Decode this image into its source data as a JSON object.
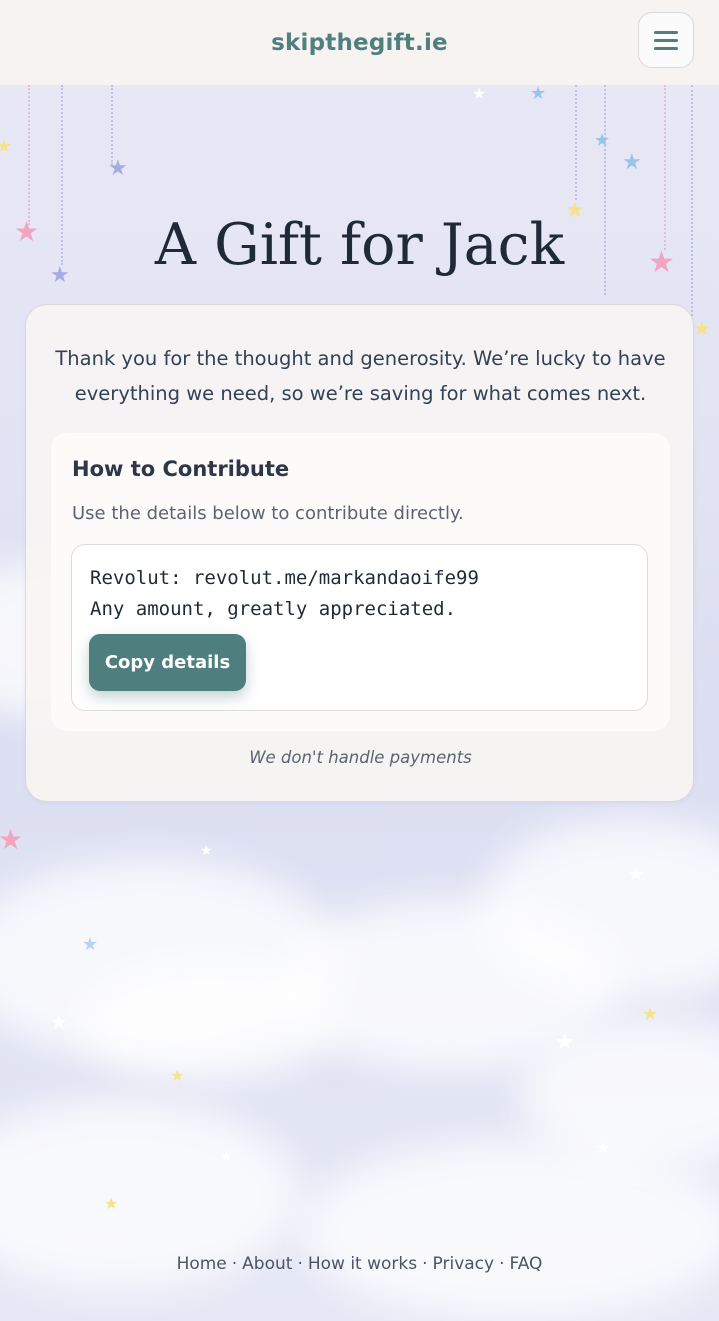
{
  "header": {
    "brand": "skipthegift.ie",
    "menu_icon": "hamburger-menu-icon"
  },
  "page": {
    "title": "A Gift for Jack",
    "intro": "Thank you for the thought and generosity. We’re lucky to have everything we need, so we’re saving for what comes next."
  },
  "contribute": {
    "heading": "How to Contribute",
    "description": "Use the details below to contribute directly.",
    "details_line1": "Revolut: revolut.me/markandaoife99",
    "details_line2": "Any amount, greatly appreciated.",
    "copy_label": "Copy details"
  },
  "disclaimer": "We don't handle payments",
  "footer": {
    "links": [
      "Home",
      "About",
      "How it works",
      "Privacy",
      "FAQ"
    ],
    "separator": "·"
  },
  "colors": {
    "accent": "#4e7f7e",
    "header_bg": "#f7f3f1",
    "sky": "#e3e4f4"
  }
}
